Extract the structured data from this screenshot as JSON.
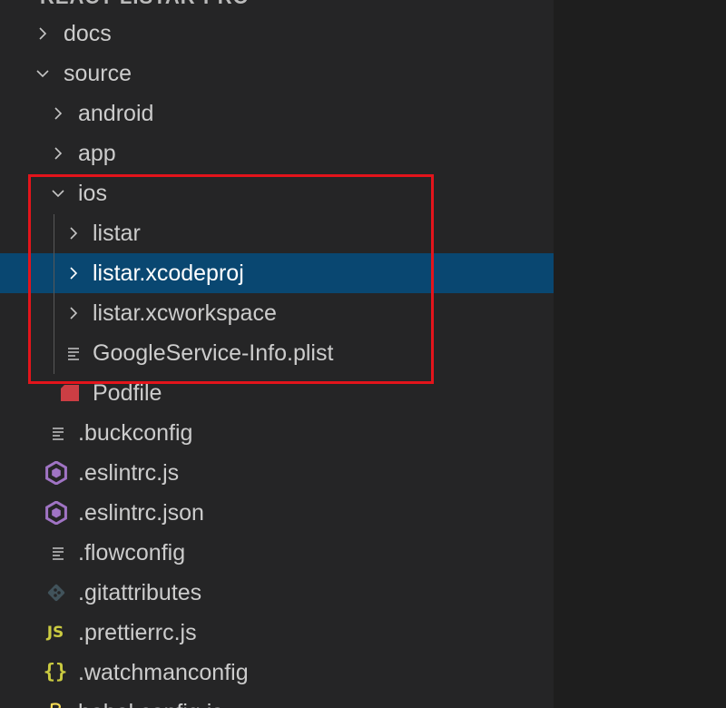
{
  "explorer": {
    "header": "REACT-LISTAR-PRO",
    "items": [
      {
        "label": "docs",
        "type": "folder",
        "expanded": false,
        "icon": "chevron-right-icon"
      },
      {
        "label": "source",
        "type": "folder",
        "expanded": true,
        "icon": "chevron-down-icon"
      },
      {
        "label": "android",
        "type": "folder",
        "expanded": false,
        "icon": "chevron-right-icon"
      },
      {
        "label": "app",
        "type": "folder",
        "expanded": false,
        "icon": "chevron-right-icon"
      },
      {
        "label": "ios",
        "type": "folder",
        "expanded": true,
        "icon": "chevron-down-icon"
      },
      {
        "label": "listar",
        "type": "folder",
        "expanded": false,
        "icon": "chevron-right-icon"
      },
      {
        "label": "listar.xcodeproj",
        "type": "folder",
        "expanded": false,
        "selected": true,
        "icon": "chevron-right-icon"
      },
      {
        "label": "listar.xcworkspace",
        "type": "folder",
        "expanded": false,
        "icon": "chevron-right-icon"
      },
      {
        "label": "GoogleService-Info.plist",
        "type": "file",
        "icon": "lines-file-icon"
      },
      {
        "label": "Podfile",
        "type": "file",
        "icon": "ruby-icon"
      },
      {
        "label": ".buckconfig",
        "type": "file",
        "icon": "lines-file-icon"
      },
      {
        "label": ".eslintrc.js",
        "type": "file",
        "icon": "eslint-icon"
      },
      {
        "label": ".eslintrc.json",
        "type": "file",
        "icon": "eslint-icon"
      },
      {
        "label": ".flowconfig",
        "type": "file",
        "icon": "lines-file-icon"
      },
      {
        "label": ".gitattributes",
        "type": "file",
        "icon": "git-icon"
      },
      {
        "label": ".prettierrc.js",
        "type": "file",
        "icon": "js-icon",
        "icon_text": "JS"
      },
      {
        "label": ".watchmanconfig",
        "type": "file",
        "icon": "braces-icon",
        "icon_text": "{}"
      },
      {
        "label": "babel.config.js",
        "type": "file",
        "icon": "babel-icon"
      }
    ]
  },
  "colors": {
    "sidebar_bg": "#252526",
    "editor_bg": "#1e1e1e",
    "selection_bg": "#094771",
    "text": "#cccccc",
    "highlight_border": "#e3141b",
    "eslint_purple": "#a074c4",
    "ruby_red": "#cc3e44",
    "js_yellow": "#cbcb41"
  }
}
